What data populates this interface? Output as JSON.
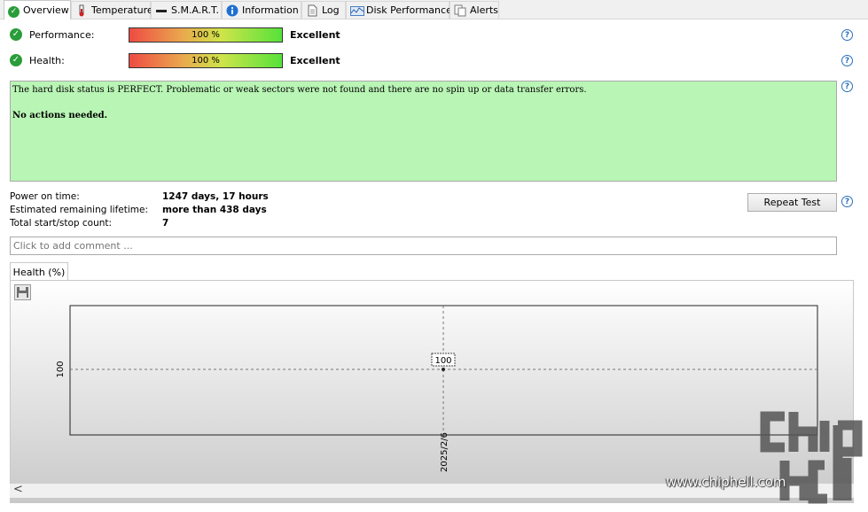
{
  "tabs": [
    {
      "label": "Overview",
      "icon": "check-circle-icon",
      "active": true
    },
    {
      "label": "Temperature",
      "icon": "thermometer-icon",
      "active": false
    },
    {
      "label": "S.M.A.R.T.",
      "icon": "dash-icon",
      "active": false
    },
    {
      "label": "Information",
      "icon": "info-icon",
      "active": false
    },
    {
      "label": "Log",
      "icon": "document-icon",
      "active": false
    },
    {
      "label": "Disk Performance",
      "icon": "performance-graph-icon",
      "active": false
    },
    {
      "label": "Alerts",
      "icon": "alerts-icon",
      "active": false
    }
  ],
  "performance": {
    "label": "Performance:",
    "percent_text": "100 %",
    "percent": 100,
    "rating": "Excellent"
  },
  "health": {
    "label": "Health:",
    "percent_text": "100 %",
    "percent": 100,
    "rating": "Excellent"
  },
  "status": {
    "message": "The hard disk status is PERFECT. Problematic or weak sectors were not found and there are no spin up or data transfer errors.",
    "action": "No actions needed."
  },
  "info": {
    "power_on_label": "Power on time:",
    "power_on_value": "1247 days, 17 hours",
    "lifetime_label": "Estimated remaining lifetime:",
    "lifetime_value": "more than 438 days",
    "startstop_label": "Total start/stop count:",
    "startstop_value": "7"
  },
  "repeat_test_label": "Repeat Test",
  "comment_placeholder": "Click to add comment ...",
  "chart_tab_label": "Health (%)",
  "chart_data": {
    "type": "line",
    "title": "Health (%)",
    "x": [
      "2025/2/6"
    ],
    "series": [
      {
        "values": [
          100
        ]
      }
    ],
    "y_tick_labels": [
      "100"
    ],
    "x_tick_labels": [
      "2025/2/6"
    ],
    "data_labels": [
      "100"
    ],
    "grid": true
  },
  "watermark": {
    "text": "www.chiphell.com",
    "logo": "chip hell"
  },
  "colors": {
    "status_bg": "#b9f5b5",
    "check_green": "#2a9d3a",
    "help_blue": "#2a6ebd"
  }
}
